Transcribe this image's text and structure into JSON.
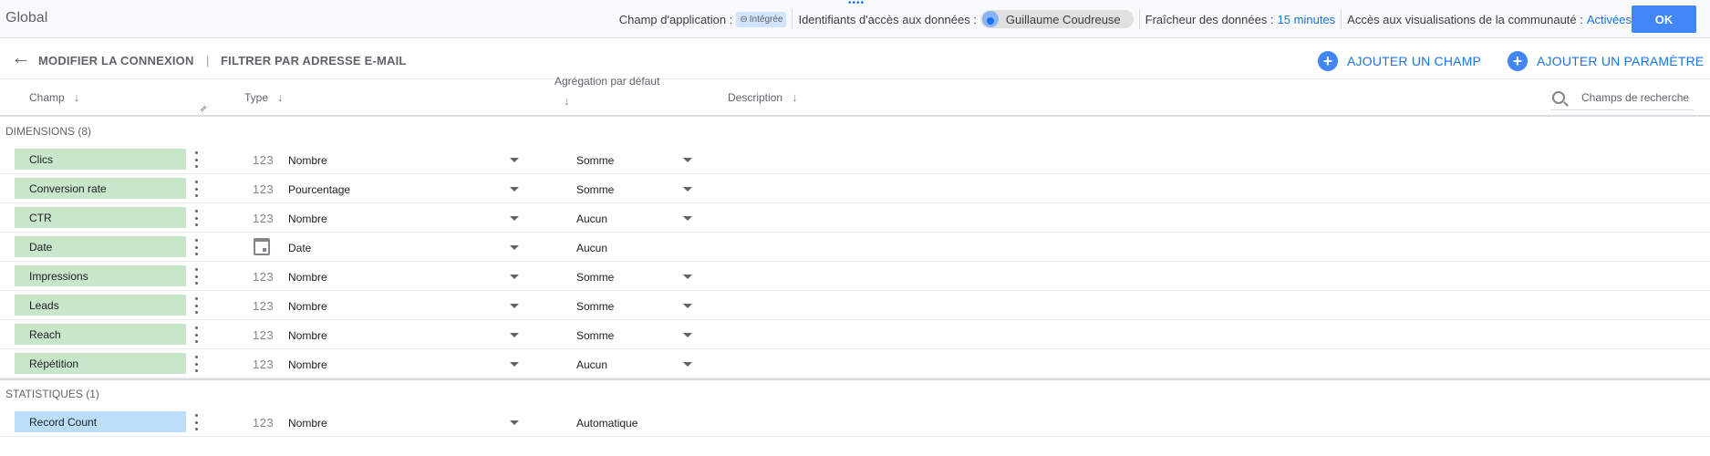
{
  "topbar": {
    "title": "Global",
    "scope_label": "Champ d'application :",
    "scope_chip": "Intégrée",
    "credentials_label": "Identifiants d'accès aux données :",
    "credentials_user": "Guillaume Coudreuse",
    "freshness_label": "Fraîcheur des données :",
    "freshness_value": "15 minutes",
    "community_label": "Accès aux visualisations de la communauté :",
    "community_value": "Activées",
    "ok_label": "OK"
  },
  "toolbar": {
    "edit_connection": "MODIFIER LA CONNEXION",
    "separator": "|",
    "filter_email": "FILTRER PAR ADRESSE E-MAIL",
    "add_field": "AJOUTER UN CHAMP",
    "add_parameter": "AJOUTER UN PARAMÈTRE"
  },
  "header": {
    "field": "Champ",
    "type": "Type",
    "aggregation": "Agrégation par défaut",
    "description": "Description",
    "search_placeholder": "Champs de recherche"
  },
  "dimensions": {
    "title": "DIMENSIONS (8)",
    "rows": [
      {
        "name": "Clics",
        "type_icon": "123",
        "type": "Nombre",
        "aggregation": "Somme",
        "agg_dropdown": true
      },
      {
        "name": "Conversion rate",
        "type_icon": "123",
        "type": "Pourcentage",
        "aggregation": "Somme",
        "agg_dropdown": true
      },
      {
        "name": "CTR",
        "type_icon": "123",
        "type": "Nombre",
        "aggregation": "Aucun",
        "agg_dropdown": true
      },
      {
        "name": "Date",
        "type_icon": "calendar",
        "type": "Date",
        "aggregation": "Aucun",
        "agg_dropdown": false
      },
      {
        "name": "Impressions",
        "type_icon": "123",
        "type": "Nombre",
        "aggregation": "Somme",
        "agg_dropdown": true
      },
      {
        "name": "Leads",
        "type_icon": "123",
        "type": "Nombre",
        "aggregation": "Somme",
        "agg_dropdown": true
      },
      {
        "name": "Reach",
        "type_icon": "123",
        "type": "Nombre",
        "aggregation": "Somme",
        "agg_dropdown": true
      },
      {
        "name": "Répétition",
        "type_icon": "123",
        "type": "Nombre",
        "aggregation": "Aucun",
        "agg_dropdown": true
      }
    ]
  },
  "metrics": {
    "title": "STATISTIQUES (1)",
    "rows": [
      {
        "name": "Record Count",
        "type_icon": "123",
        "type": "Nombre",
        "aggregation": "Automatique",
        "agg_dropdown": false
      }
    ]
  },
  "colors": {
    "accent": "#1a73e8",
    "dimension_chip": "#c8e6c9",
    "metric_chip": "#bbdefb",
    "ok_button": "#4285f4"
  }
}
